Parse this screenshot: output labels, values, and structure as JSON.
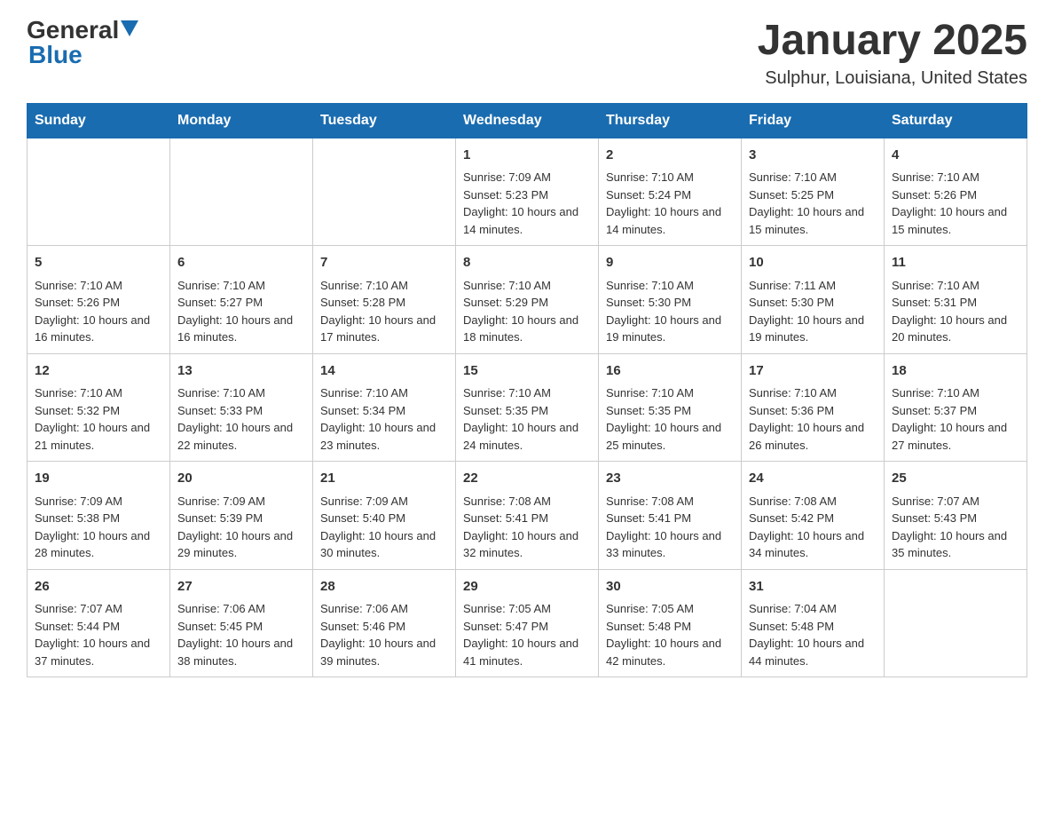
{
  "header": {
    "logo_text_general": "General",
    "logo_text_blue": "Blue",
    "title": "January 2025",
    "subtitle": "Sulphur, Louisiana, United States"
  },
  "calendar": {
    "weekdays": [
      "Sunday",
      "Monday",
      "Tuesday",
      "Wednesday",
      "Thursday",
      "Friday",
      "Saturday"
    ],
    "weeks": [
      [
        {
          "day": "",
          "info": ""
        },
        {
          "day": "",
          "info": ""
        },
        {
          "day": "",
          "info": ""
        },
        {
          "day": "1",
          "info": "Sunrise: 7:09 AM\nSunset: 5:23 PM\nDaylight: 10 hours and 14 minutes."
        },
        {
          "day": "2",
          "info": "Sunrise: 7:10 AM\nSunset: 5:24 PM\nDaylight: 10 hours and 14 minutes."
        },
        {
          "day": "3",
          "info": "Sunrise: 7:10 AM\nSunset: 5:25 PM\nDaylight: 10 hours and 15 minutes."
        },
        {
          "day": "4",
          "info": "Sunrise: 7:10 AM\nSunset: 5:26 PM\nDaylight: 10 hours and 15 minutes."
        }
      ],
      [
        {
          "day": "5",
          "info": "Sunrise: 7:10 AM\nSunset: 5:26 PM\nDaylight: 10 hours and 16 minutes."
        },
        {
          "day": "6",
          "info": "Sunrise: 7:10 AM\nSunset: 5:27 PM\nDaylight: 10 hours and 16 minutes."
        },
        {
          "day": "7",
          "info": "Sunrise: 7:10 AM\nSunset: 5:28 PM\nDaylight: 10 hours and 17 minutes."
        },
        {
          "day": "8",
          "info": "Sunrise: 7:10 AM\nSunset: 5:29 PM\nDaylight: 10 hours and 18 minutes."
        },
        {
          "day": "9",
          "info": "Sunrise: 7:10 AM\nSunset: 5:30 PM\nDaylight: 10 hours and 19 minutes."
        },
        {
          "day": "10",
          "info": "Sunrise: 7:11 AM\nSunset: 5:30 PM\nDaylight: 10 hours and 19 minutes."
        },
        {
          "day": "11",
          "info": "Sunrise: 7:10 AM\nSunset: 5:31 PM\nDaylight: 10 hours and 20 minutes."
        }
      ],
      [
        {
          "day": "12",
          "info": "Sunrise: 7:10 AM\nSunset: 5:32 PM\nDaylight: 10 hours and 21 minutes."
        },
        {
          "day": "13",
          "info": "Sunrise: 7:10 AM\nSunset: 5:33 PM\nDaylight: 10 hours and 22 minutes."
        },
        {
          "day": "14",
          "info": "Sunrise: 7:10 AM\nSunset: 5:34 PM\nDaylight: 10 hours and 23 minutes."
        },
        {
          "day": "15",
          "info": "Sunrise: 7:10 AM\nSunset: 5:35 PM\nDaylight: 10 hours and 24 minutes."
        },
        {
          "day": "16",
          "info": "Sunrise: 7:10 AM\nSunset: 5:35 PM\nDaylight: 10 hours and 25 minutes."
        },
        {
          "day": "17",
          "info": "Sunrise: 7:10 AM\nSunset: 5:36 PM\nDaylight: 10 hours and 26 minutes."
        },
        {
          "day": "18",
          "info": "Sunrise: 7:10 AM\nSunset: 5:37 PM\nDaylight: 10 hours and 27 minutes."
        }
      ],
      [
        {
          "day": "19",
          "info": "Sunrise: 7:09 AM\nSunset: 5:38 PM\nDaylight: 10 hours and 28 minutes."
        },
        {
          "day": "20",
          "info": "Sunrise: 7:09 AM\nSunset: 5:39 PM\nDaylight: 10 hours and 29 minutes."
        },
        {
          "day": "21",
          "info": "Sunrise: 7:09 AM\nSunset: 5:40 PM\nDaylight: 10 hours and 30 minutes."
        },
        {
          "day": "22",
          "info": "Sunrise: 7:08 AM\nSunset: 5:41 PM\nDaylight: 10 hours and 32 minutes."
        },
        {
          "day": "23",
          "info": "Sunrise: 7:08 AM\nSunset: 5:41 PM\nDaylight: 10 hours and 33 minutes."
        },
        {
          "day": "24",
          "info": "Sunrise: 7:08 AM\nSunset: 5:42 PM\nDaylight: 10 hours and 34 minutes."
        },
        {
          "day": "25",
          "info": "Sunrise: 7:07 AM\nSunset: 5:43 PM\nDaylight: 10 hours and 35 minutes."
        }
      ],
      [
        {
          "day": "26",
          "info": "Sunrise: 7:07 AM\nSunset: 5:44 PM\nDaylight: 10 hours and 37 minutes."
        },
        {
          "day": "27",
          "info": "Sunrise: 7:06 AM\nSunset: 5:45 PM\nDaylight: 10 hours and 38 minutes."
        },
        {
          "day": "28",
          "info": "Sunrise: 7:06 AM\nSunset: 5:46 PM\nDaylight: 10 hours and 39 minutes."
        },
        {
          "day": "29",
          "info": "Sunrise: 7:05 AM\nSunset: 5:47 PM\nDaylight: 10 hours and 41 minutes."
        },
        {
          "day": "30",
          "info": "Sunrise: 7:05 AM\nSunset: 5:48 PM\nDaylight: 10 hours and 42 minutes."
        },
        {
          "day": "31",
          "info": "Sunrise: 7:04 AM\nSunset: 5:48 PM\nDaylight: 10 hours and 44 minutes."
        },
        {
          "day": "",
          "info": ""
        }
      ]
    ]
  }
}
